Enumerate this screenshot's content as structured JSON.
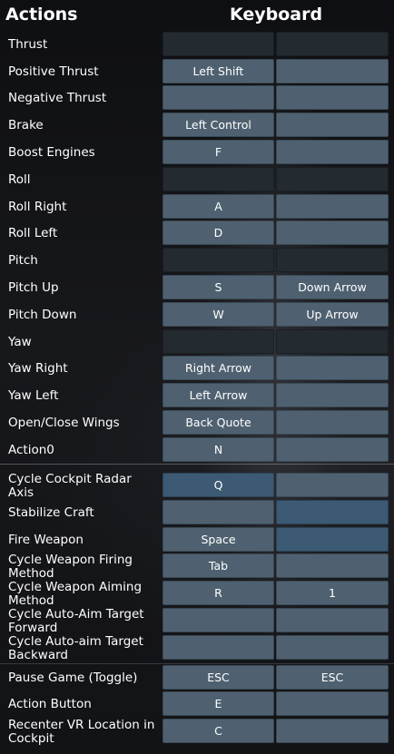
{
  "header": {
    "actions": "Actions",
    "keyboard": "Keyboard"
  },
  "rows": [
    {
      "label": "Thrust",
      "key1": "",
      "key2": ""
    },
    {
      "label": "Positive Thrust",
      "key1": "Left Shift",
      "key2": ""
    },
    {
      "label": "Negative Thrust",
      "key1": "",
      "key2": ""
    },
    {
      "label": "Brake",
      "key1": "Left Control",
      "key2": ""
    },
    {
      "label": "Boost Engines",
      "key1": "F",
      "key2": ""
    },
    {
      "label": "Roll",
      "key1": "",
      "key2": ""
    },
    {
      "label": "Roll Right",
      "key1": "A",
      "key2": ""
    },
    {
      "label": "Roll Left",
      "key1": "D",
      "key2": ""
    },
    {
      "label": "Pitch",
      "key1": "",
      "key2": ""
    },
    {
      "label": "Pitch Up",
      "key1": "S",
      "key2": "Down Arrow"
    },
    {
      "label": "Pitch Down",
      "key1": "W",
      "key2": "Up Arrow"
    },
    {
      "label": "Yaw",
      "key1": "",
      "key2": ""
    },
    {
      "label": "Yaw Right",
      "key1": "Right Arrow",
      "key2": ""
    },
    {
      "label": "Yaw Left",
      "key1": "Left Arrow",
      "key2": ""
    },
    {
      "label": "Open/Close Wings",
      "key1": "Back Quote",
      "key2": ""
    },
    {
      "label": "Action0",
      "key1": "N",
      "key2": ""
    },
    {
      "label": "Cycle Cockpit Radar Axis",
      "key1": "Q",
      "key2": ""
    },
    {
      "label": "Stabilize Craft",
      "key1": "",
      "key2": ""
    },
    {
      "label": "Fire Weapon",
      "key1": "Space",
      "key2": ""
    },
    {
      "label": "Cycle Weapon Firing Method",
      "key1": "Tab",
      "key2": ""
    },
    {
      "label": "Cycle Weapon Aiming Method",
      "key1": "R",
      "key2": "1"
    },
    {
      "label": "Cycle Auto-Aim Target Forward",
      "key1": "",
      "key2": ""
    },
    {
      "label": "Cycle Auto-aim Target Backward",
      "key1": "",
      "key2": ""
    },
    {
      "label": "Pause Game (Toggle)",
      "key1": "ESC",
      "key2": "ESC"
    },
    {
      "label": "Action Button",
      "key1": "E",
      "key2": ""
    },
    {
      "label": "Recenter VR Location in Cockpit",
      "key1": "C",
      "key2": ""
    }
  ]
}
